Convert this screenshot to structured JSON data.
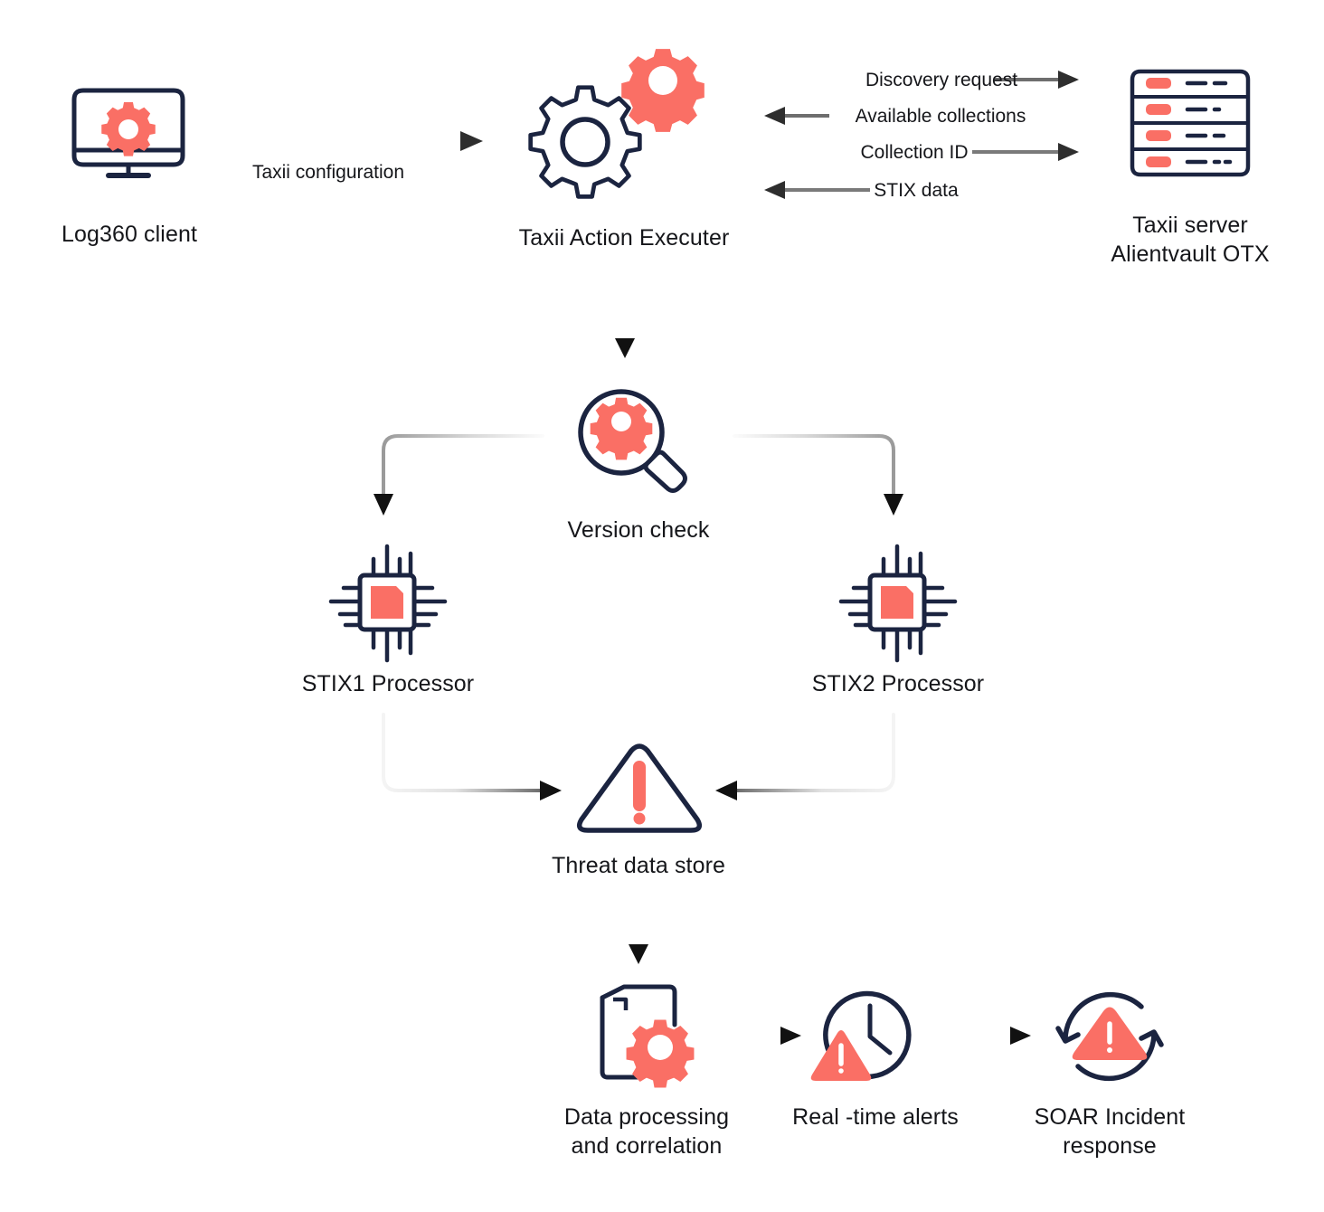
{
  "diagram": {
    "title_visible": false,
    "background": "#ffffff",
    "colors": {
      "coral": "#fa6f65",
      "navy": "#1b2440",
      "text": "#15161a",
      "arrow_dark": "#3a3a3a",
      "arrow_light": "#f2f2f2"
    }
  },
  "nodes": {
    "log360_client": {
      "label": "Log360 client",
      "icon": "monitor-gear-icon"
    },
    "taxii_action_executer": {
      "label": "Taxii Action Executer",
      "icon": "two-gears-icon"
    },
    "taxii_server": {
      "label": "Taxii  server\nAlientvault OTX",
      "icon": "server-rack-icon"
    },
    "version_check": {
      "label": "Version check",
      "icon": "magnifier-gear-icon"
    },
    "stix1_processor": {
      "label": "STIX1 Processor",
      "icon": "cpu-chip-icon"
    },
    "stix2_processor": {
      "label": "STIX2 Processor",
      "icon": "cpu-chip-icon"
    },
    "threat_data_store": {
      "label": "Threat data store",
      "icon": "warning-triangle-outline-icon"
    },
    "data_processing": {
      "label": "Data  processing\nand correlation",
      "icon": "document-gear-icon"
    },
    "realtime_alerts": {
      "label": "Real -time alerts",
      "icon": "clock-alert-icon"
    },
    "soar_incident": {
      "label": "SOAR Incident\nresponse",
      "icon": "cycle-alert-icon"
    }
  },
  "connectors": {
    "taxii_configuration": {
      "label": "Taxii configuration",
      "direction": "right"
    },
    "discovery_request": {
      "label": "Discovery request",
      "direction": "right"
    },
    "available_collections": {
      "label": "Available collections",
      "direction": "left"
    },
    "collection_id": {
      "label": "Collection ID",
      "direction": "right"
    },
    "stix_data": {
      "label": "STIX data",
      "direction": "left"
    },
    "executer_to_version": {
      "label": "",
      "direction": "down"
    },
    "version_to_stix1": {
      "label": "",
      "direction": "down-left"
    },
    "version_to_stix2": {
      "label": "",
      "direction": "down-right"
    },
    "stix1_to_store": {
      "label": "",
      "direction": "down-right"
    },
    "stix2_to_store": {
      "label": "",
      "direction": "down-left"
    },
    "store_to_processing": {
      "label": "",
      "direction": "down"
    },
    "processing_to_alerts": {
      "label": "",
      "direction": "right"
    },
    "alerts_to_soar": {
      "label": "",
      "direction": "right"
    }
  }
}
